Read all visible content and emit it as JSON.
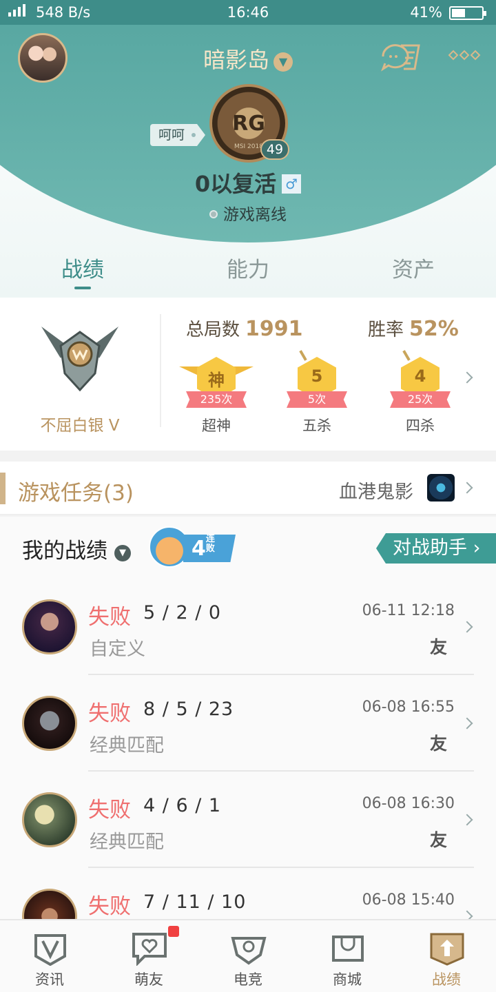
{
  "status_bar": {
    "network": "4G",
    "speed": "548 B/s",
    "time": "16:46",
    "battery": "41%",
    "battery_level": 0.41
  },
  "profile": {
    "server": "暗影岛",
    "tag": "呵呵",
    "rank_logo_text": "MSI 2018",
    "level": "49",
    "nickname": "0以复活",
    "gender": "♂",
    "status": "游戏离线"
  },
  "tabs": [
    {
      "label": "战绩"
    },
    {
      "label": "能力"
    },
    {
      "label": "资产"
    }
  ],
  "stats": {
    "tier": "不屈白银 V",
    "total_label": "总局数",
    "total_value": "1991",
    "winrate_label": "胜率",
    "winrate_value": "52%",
    "medals": [
      {
        "glyph": "神",
        "count": "235次",
        "label": "超神"
      },
      {
        "glyph": "5",
        "count": "5次",
        "label": "五杀"
      },
      {
        "glyph": "4",
        "count": "25次",
        "label": "四杀"
      }
    ]
  },
  "task": {
    "title": "游戏任务(3)",
    "name": "血港鬼影"
  },
  "history": {
    "title": "我的战绩",
    "streak_number": "4",
    "streak_text": "连败",
    "assistant_label": "对战助手 ›",
    "matches": [
      {
        "result": "失败",
        "kda": "5 / 2 / 0",
        "mode": "自定义",
        "date": "06-11 12:18",
        "friend": "友"
      },
      {
        "result": "失败",
        "kda": "8 / 5 / 23",
        "mode": "经典匹配",
        "date": "06-08 16:55",
        "friend": "友"
      },
      {
        "result": "失败",
        "kda": "4 / 6 / 1",
        "mode": "经典匹配",
        "date": "06-08 16:30",
        "friend": "友"
      },
      {
        "result": "失败",
        "kda": "7 / 11 / 10",
        "mode": "",
        "date": "06-08 15:40",
        "friend": ""
      }
    ]
  },
  "nav": [
    {
      "label": "资讯",
      "icon": "news-icon"
    },
    {
      "label": "萌友",
      "icon": "friends-icon"
    },
    {
      "label": "电竞",
      "icon": "esports-icon"
    },
    {
      "label": "商城",
      "icon": "shop-icon"
    },
    {
      "label": "战绩",
      "icon": "record-icon"
    }
  ],
  "colors": {
    "accent": "#3e8d89",
    "gold": "#b9935f",
    "loss": "#ef6f6f"
  }
}
